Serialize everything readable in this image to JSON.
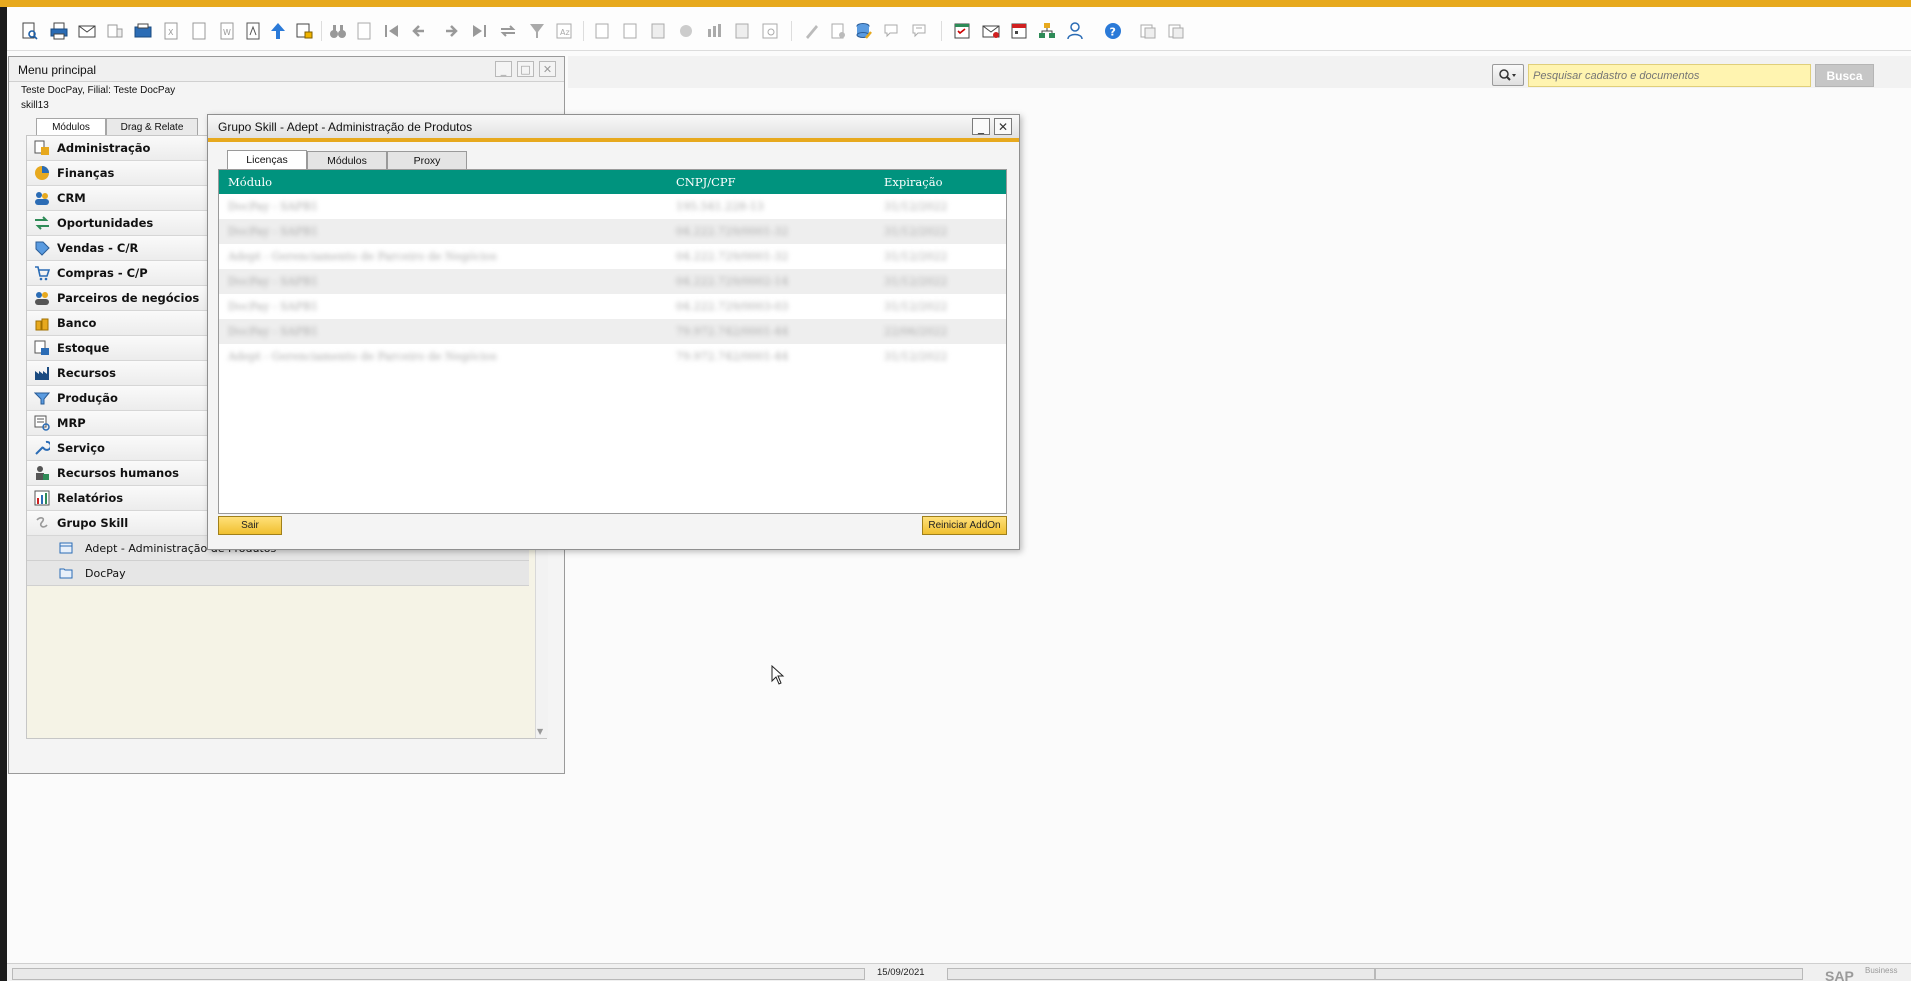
{
  "search": {
    "placeholder": "Pesquisar cadastro e documentos",
    "button_label": "Busca"
  },
  "main_menu": {
    "title": "Menu principal",
    "company": "Teste DocPay, Filial: Teste DocPay",
    "user": "skill13",
    "tabs": [
      "Módulos",
      "Drag & Relate"
    ],
    "items": [
      {
        "label": "Administração",
        "icon": "admin-icon"
      },
      {
        "label": "Finanças",
        "icon": "finance-pie-icon"
      },
      {
        "label": "CRM",
        "icon": "crm-icon"
      },
      {
        "label": "Oportunidades",
        "icon": "opportunities-icon"
      },
      {
        "label": "Vendas - C/R",
        "icon": "sales-tag-icon"
      },
      {
        "label": "Compras - C/P",
        "icon": "shopping-cart-icon"
      },
      {
        "label": "Parceiros de negócios",
        "icon": "partners-icon"
      },
      {
        "label": "Banco",
        "icon": "bank-icon"
      },
      {
        "label": "Estoque",
        "icon": "inventory-icon"
      },
      {
        "label": "Recursos",
        "icon": "resources-icon"
      },
      {
        "label": "Produção",
        "icon": "production-icon"
      },
      {
        "label": "MRP",
        "icon": "mrp-icon"
      },
      {
        "label": "Serviço",
        "icon": "service-wrench-icon"
      },
      {
        "label": "Recursos humanos",
        "icon": "hr-icon"
      },
      {
        "label": "Relatórios",
        "icon": "reports-chart-icon"
      },
      {
        "label": "Grupo Skill",
        "icon": "skill-group-icon"
      }
    ],
    "subitems": [
      {
        "label": "Adept - Administração de Produtos",
        "icon": "form-icon"
      },
      {
        "label": "DocPay",
        "icon": "folder-icon"
      }
    ]
  },
  "dialog": {
    "title": "Grupo Skill - Adept - Administração de Produtos",
    "tabs": [
      "Licenças",
      "Módulos",
      "Proxy"
    ],
    "columns": [
      "Módulo",
      "CNPJ/CPF",
      "Expiração"
    ],
    "rows": [
      [
        "DocPay - SAPB1",
        "195.541.228-13",
        "31/12/2022"
      ],
      [
        "DocPay - SAPB1",
        "04.222.729/0001-32",
        "31/12/2022"
      ],
      [
        "Adept - Gerenciamento de Parceiro de Negócios",
        "04.222.729/0001-32",
        "31/12/2022"
      ],
      [
        "DocPay - SAPB1",
        "04.222.729/0002-14",
        "31/12/2022"
      ],
      [
        "DocPay - SAPB1",
        "04.222.729/0003-03",
        "31/12/2022"
      ],
      [
        "DocPay - SAPB1",
        "79.972.742/0001-44",
        "22/06/2022"
      ],
      [
        "Adept - Gerenciamento de Parceiro de Negócios",
        "79.972.742/0001-44",
        "31/12/2022"
      ]
    ],
    "exit_label": "Sair",
    "restart_label": "Reiniciar AddOn"
  },
  "status": {
    "date": "15/09/2021",
    "brand": "SAP",
    "brand_sub": "Business"
  }
}
